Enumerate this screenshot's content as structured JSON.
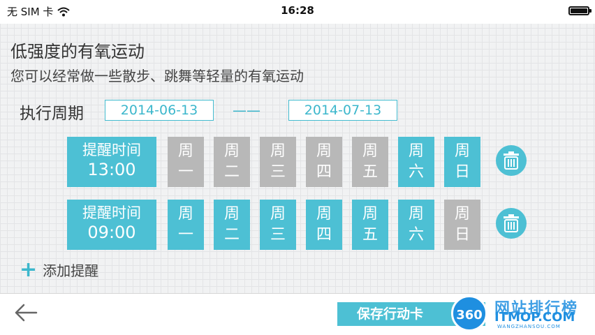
{
  "status_bar": {
    "carrier": "无 SIM 卡",
    "time": "16:28"
  },
  "header": {
    "title": "低强度的有氧运动",
    "subtitle": "您可以经常做一些散步、跳舞等轻量的有氧运动"
  },
  "period": {
    "label": "执行周期",
    "start_date": "2014-06-13",
    "separator": "——",
    "end_date": "2014-07-13"
  },
  "reminders": [
    {
      "label": "提醒时间",
      "time": "13:00",
      "days": [
        {
          "top": "周",
          "bottom": "一",
          "active": false
        },
        {
          "top": "周",
          "bottom": "二",
          "active": false
        },
        {
          "top": "周",
          "bottom": "三",
          "active": false
        },
        {
          "top": "周",
          "bottom": "四",
          "active": false
        },
        {
          "top": "周",
          "bottom": "五",
          "active": false
        },
        {
          "top": "周",
          "bottom": "六",
          "active": true
        },
        {
          "top": "周",
          "bottom": "日",
          "active": true
        }
      ]
    },
    {
      "label": "提醒时间",
      "time": "09:00",
      "days": [
        {
          "top": "周",
          "bottom": "一",
          "active": true
        },
        {
          "top": "周",
          "bottom": "二",
          "active": true
        },
        {
          "top": "周",
          "bottom": "三",
          "active": true
        },
        {
          "top": "周",
          "bottom": "四",
          "active": true
        },
        {
          "top": "周",
          "bottom": "五",
          "active": true
        },
        {
          "top": "周",
          "bottom": "六",
          "active": true
        },
        {
          "top": "周",
          "bottom": "日",
          "active": false
        }
      ]
    }
  ],
  "add_reminder": {
    "icon": "plus-icon",
    "label": "添加提醒"
  },
  "bottom_bar": {
    "back_icon": "back-arrow-icon",
    "save_label": "保存行动卡"
  },
  "watermark": {
    "badge": "360",
    "title": "网站排行榜",
    "domain": "ITMOP.COM",
    "sub": "WANGZHANSOU.COM"
  },
  "colors": {
    "accent": "#4dc0d4",
    "inactive": "#b8b8b8",
    "background": "#f1f2f3"
  }
}
